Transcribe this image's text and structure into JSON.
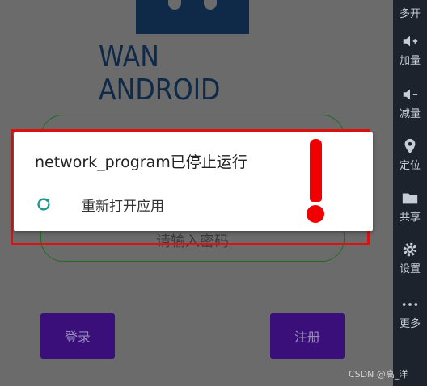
{
  "app": {
    "logo_text": "WAN ANDROID",
    "password_hint": "请输入密码",
    "login_label": "登录",
    "register_label": "注册"
  },
  "dialog": {
    "title": "network_program已停止运行",
    "action_label": "重新打开应用",
    "action_icon": "refresh-icon"
  },
  "toolbar": {
    "items": [
      {
        "label": "多开",
        "icon": "multi-instance-icon"
      },
      {
        "label": "加量",
        "icon": "volume-up-icon"
      },
      {
        "label": "减量",
        "icon": "volume-down-icon"
      },
      {
        "label": "定位",
        "icon": "location-icon"
      },
      {
        "label": "共享",
        "icon": "folder-icon"
      },
      {
        "label": "设置",
        "icon": "gear-icon"
      },
      {
        "label": "更多",
        "icon": "more-icon"
      }
    ]
  },
  "watermark": "CSDN @高_洋",
  "colors": {
    "annotation_red": "#e01010",
    "button_purple": "#3b0f7a",
    "field_green": "#1f6e1f",
    "logo_navy": "#0e2a48",
    "toolbar_bg": "#1c232c",
    "reopen_icon": "#1a9a8a"
  }
}
